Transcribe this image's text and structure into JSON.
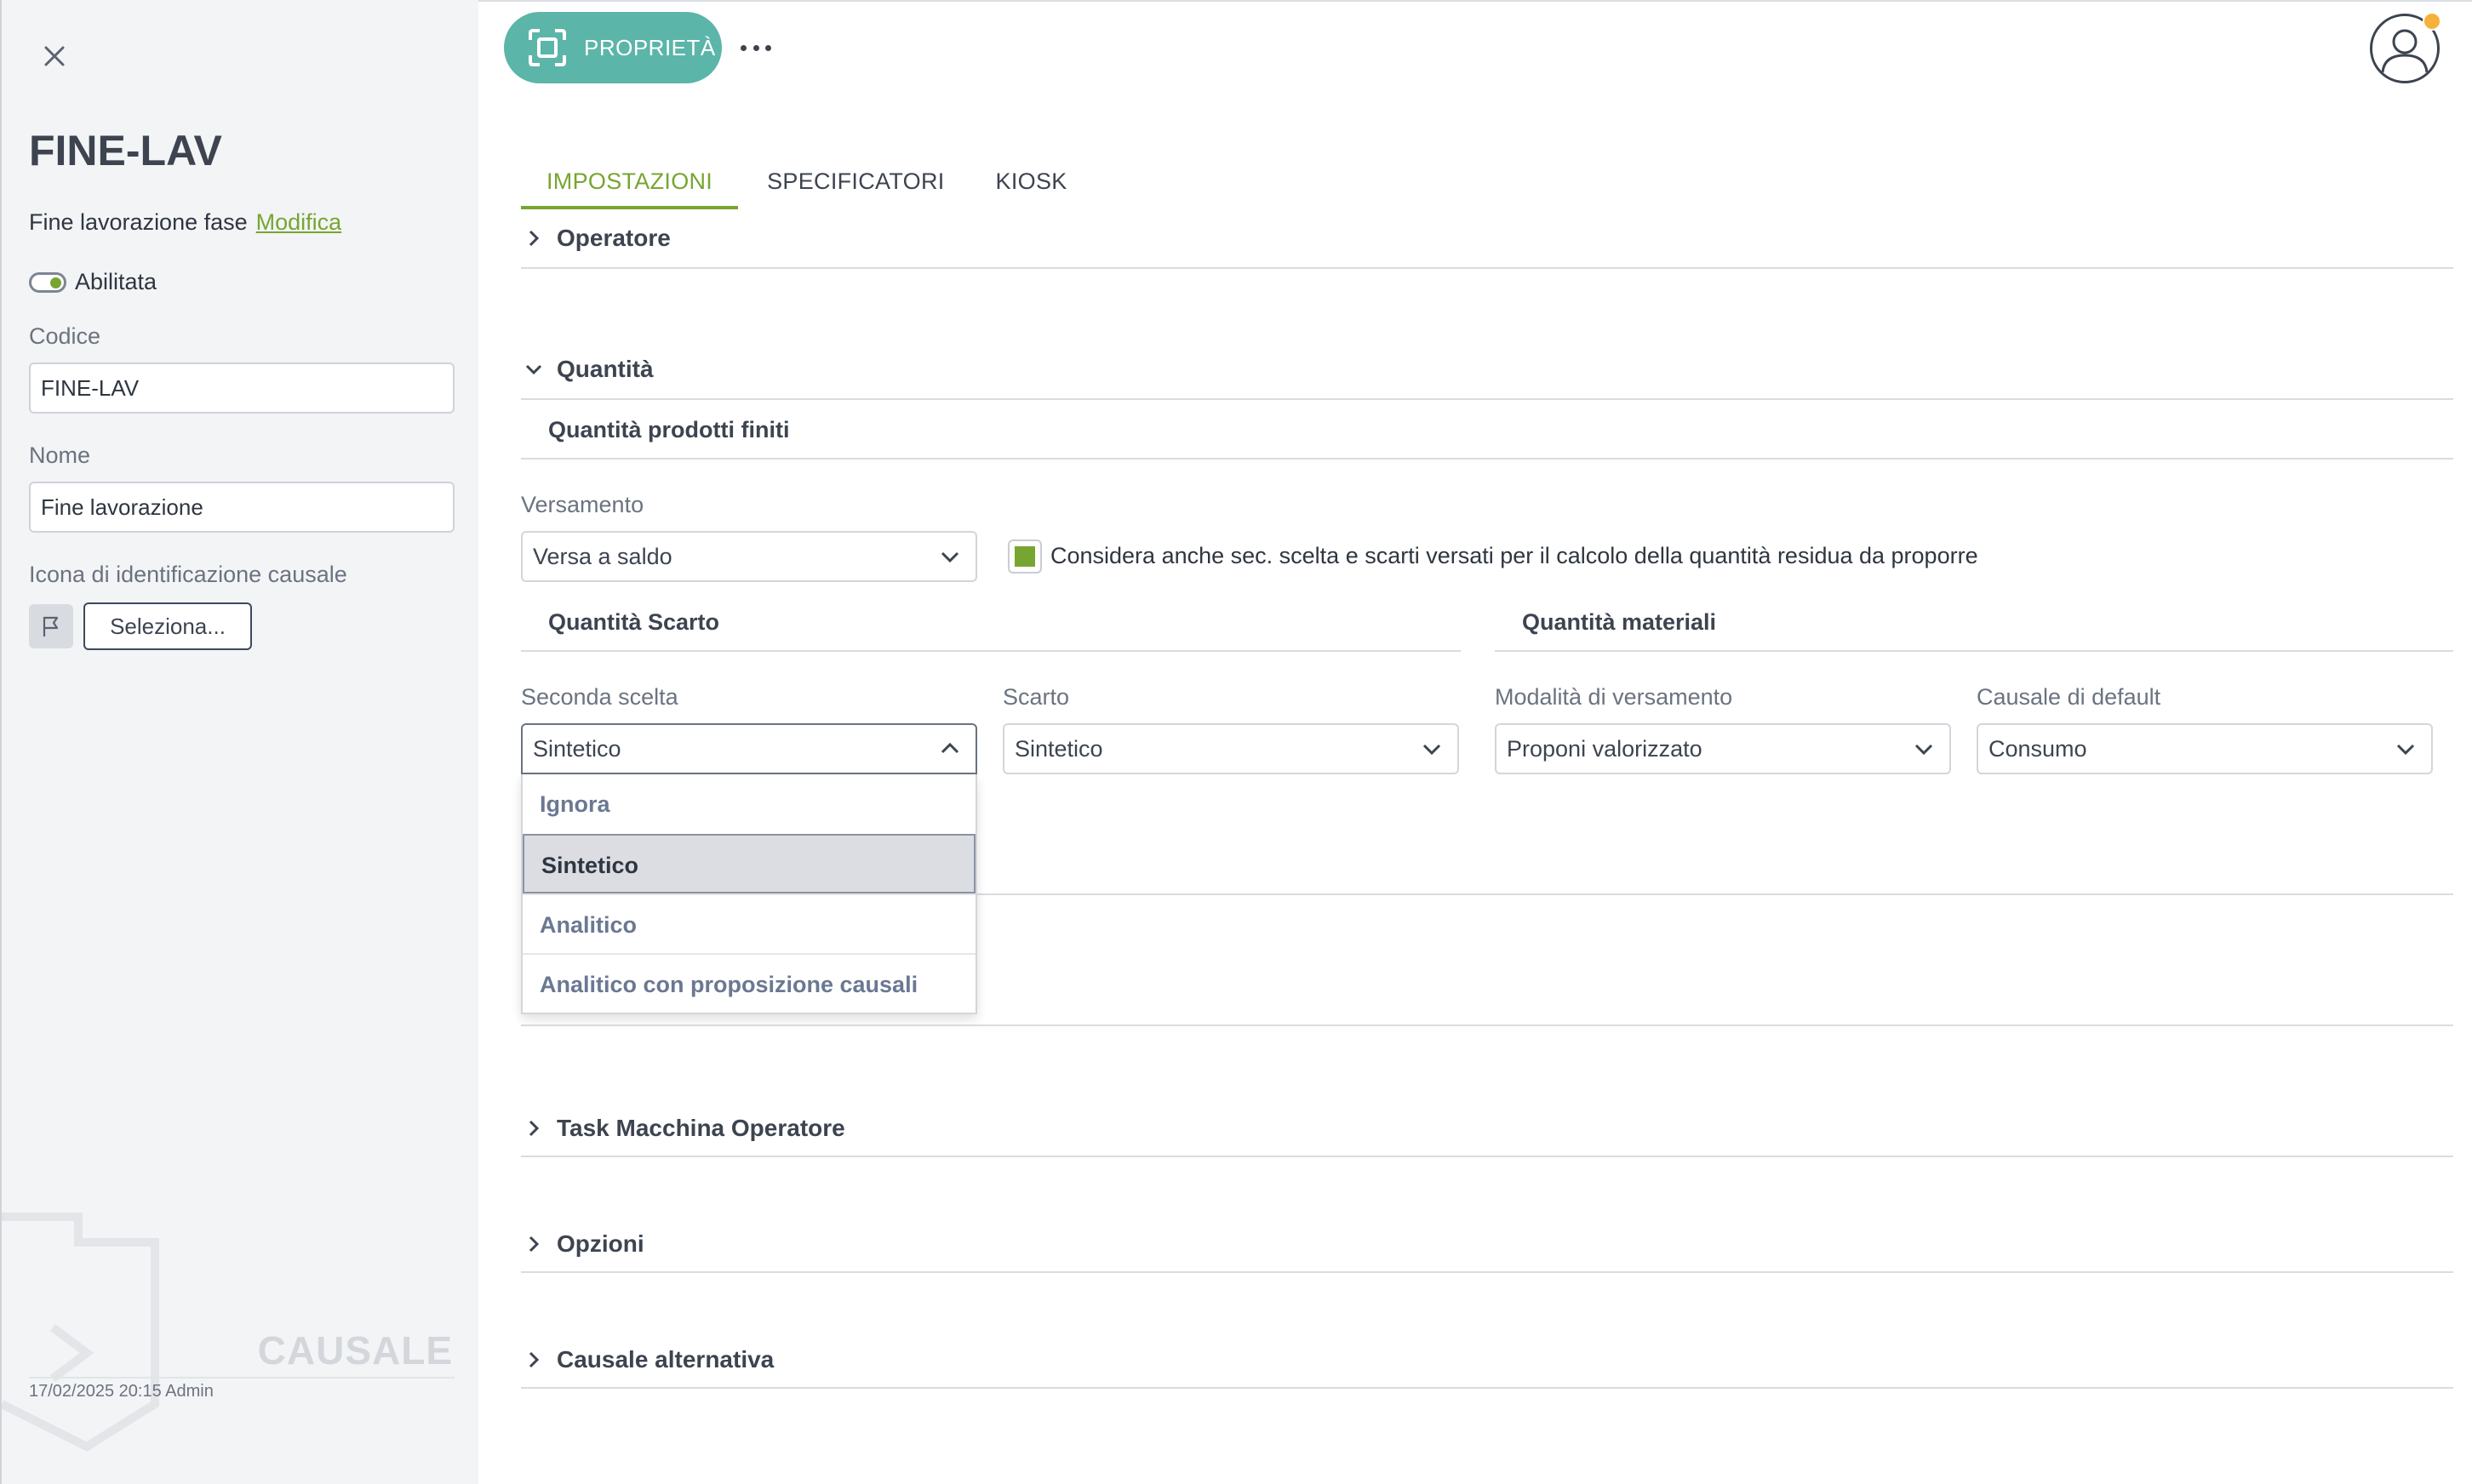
{
  "sidebar": {
    "title": "FINE-LAV",
    "description": "Fine lavorazione fase",
    "edit_link": "Modifica",
    "enabled_label": "Abilitata",
    "code_label": "Codice",
    "code_value": "FINE-LAV",
    "name_label": "Nome",
    "name_value": "Fine lavorazione",
    "icon_label": "Icona di identificazione causale",
    "select_button": "Seleziona...",
    "entity_type": "CAUSALE",
    "footer": "17/02/2025 20:15 Admin"
  },
  "toolbar": {
    "properties_button": "PROPRIETÀ"
  },
  "tabs": [
    {
      "label": "IMPOSTAZIONI",
      "active": true
    },
    {
      "label": "SPECIFICATORI",
      "active": false
    },
    {
      "label": "KIOSK",
      "active": false
    }
  ],
  "sections": {
    "operatore": "Operatore",
    "quantita": "Quantità",
    "task": "Task Macchina Operatore",
    "opzioni": "Opzioni",
    "causale_alt": "Causale alternativa"
  },
  "quantita": {
    "finished_title": "Quantità prodotti finiti",
    "versamento_label": "Versamento",
    "versamento_value": "Versa a saldo",
    "consider_checkbox": "Considera anche sec. scelta e scarti versati per il calcolo della quantità residua da proporre",
    "consider_checked": true,
    "scrap_title": "Quantità Scarto",
    "materials_title": "Quantità materiali",
    "second_choice_label": "Seconda scelta",
    "second_choice_value": "Sintetico",
    "scrap_label": "Scarto",
    "scrap_value": "Sintetico",
    "mode_label": "Modalità di versamento",
    "mode_value": "Proponi valorizzato",
    "default_reason_label": "Causale di default",
    "default_reason_value": "Consumo"
  },
  "dropdown": {
    "options": [
      "Ignora",
      "Sintetico",
      "Analitico",
      "Analitico con proposizione causali"
    ],
    "selected": "Sintetico"
  },
  "colors": {
    "accent_green": "#77a531",
    "teal_button": "#5cb5a9",
    "badge": "#f4b23a"
  }
}
